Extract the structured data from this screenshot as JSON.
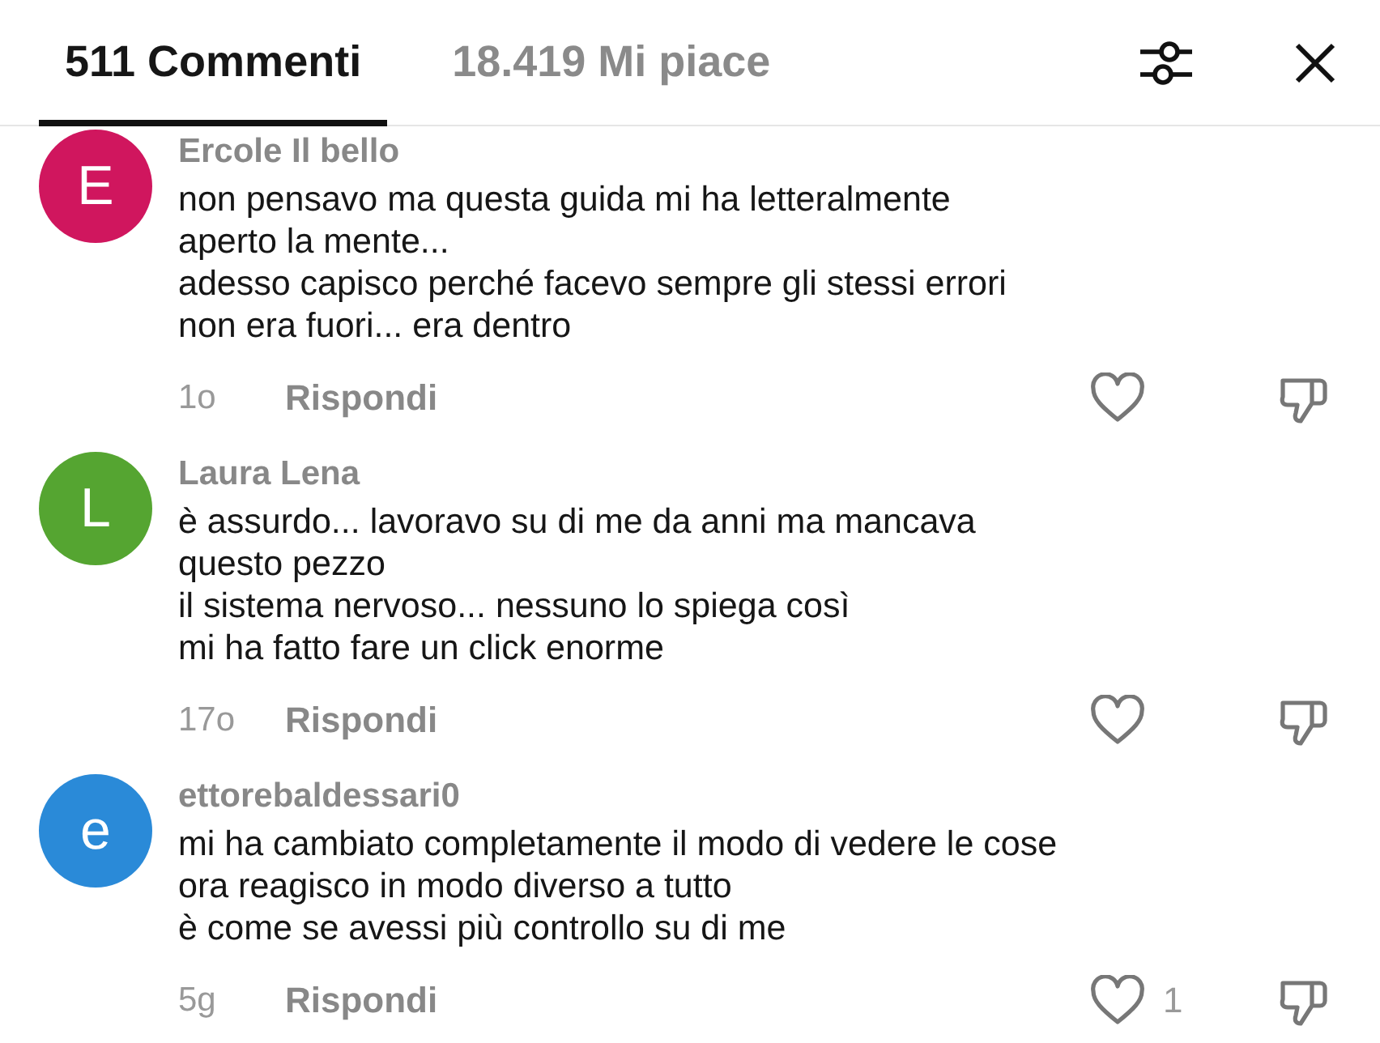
{
  "tabs": [
    {
      "label": "511 Commenti",
      "selected": true
    },
    {
      "label": "18.419 Mi piace",
      "selected": false
    }
  ],
  "comments": [
    {
      "initial": "E",
      "color": "#d0165e",
      "author": "Ercole Il bello",
      "lines": [
        "non pensavo ma questa guida mi ha letteralmente",
        "aperto la mente...",
        "adesso capisco perché facevo sempre gli stessi errori",
        "non era fuori... era dentro"
      ],
      "time": "1o",
      "reply": "Rispondi"
    },
    {
      "initial": "L",
      "color": "#55a531",
      "author": "Laura Lena",
      "lines": [
        "è assurdo... lavoravo su di me da anni ma mancava",
        "questo pezzo",
        "il sistema nervoso... nessuno lo spiega così",
        "mi ha fatto fare un click enorme"
      ],
      "time": "17o",
      "reply": "Rispondi"
    },
    {
      "initial": "e",
      "color": "#2a8ad8",
      "author": "ettorebaldessari0",
      "lines": [
        "mi ha cambiato completamente il modo di vedere le cose",
        "ora reagisco in modo diverso a tutto",
        "è come se avessi più controllo su di me"
      ],
      "time": "5g",
      "reply": "Rispondi",
      "likes": "1"
    }
  ]
}
